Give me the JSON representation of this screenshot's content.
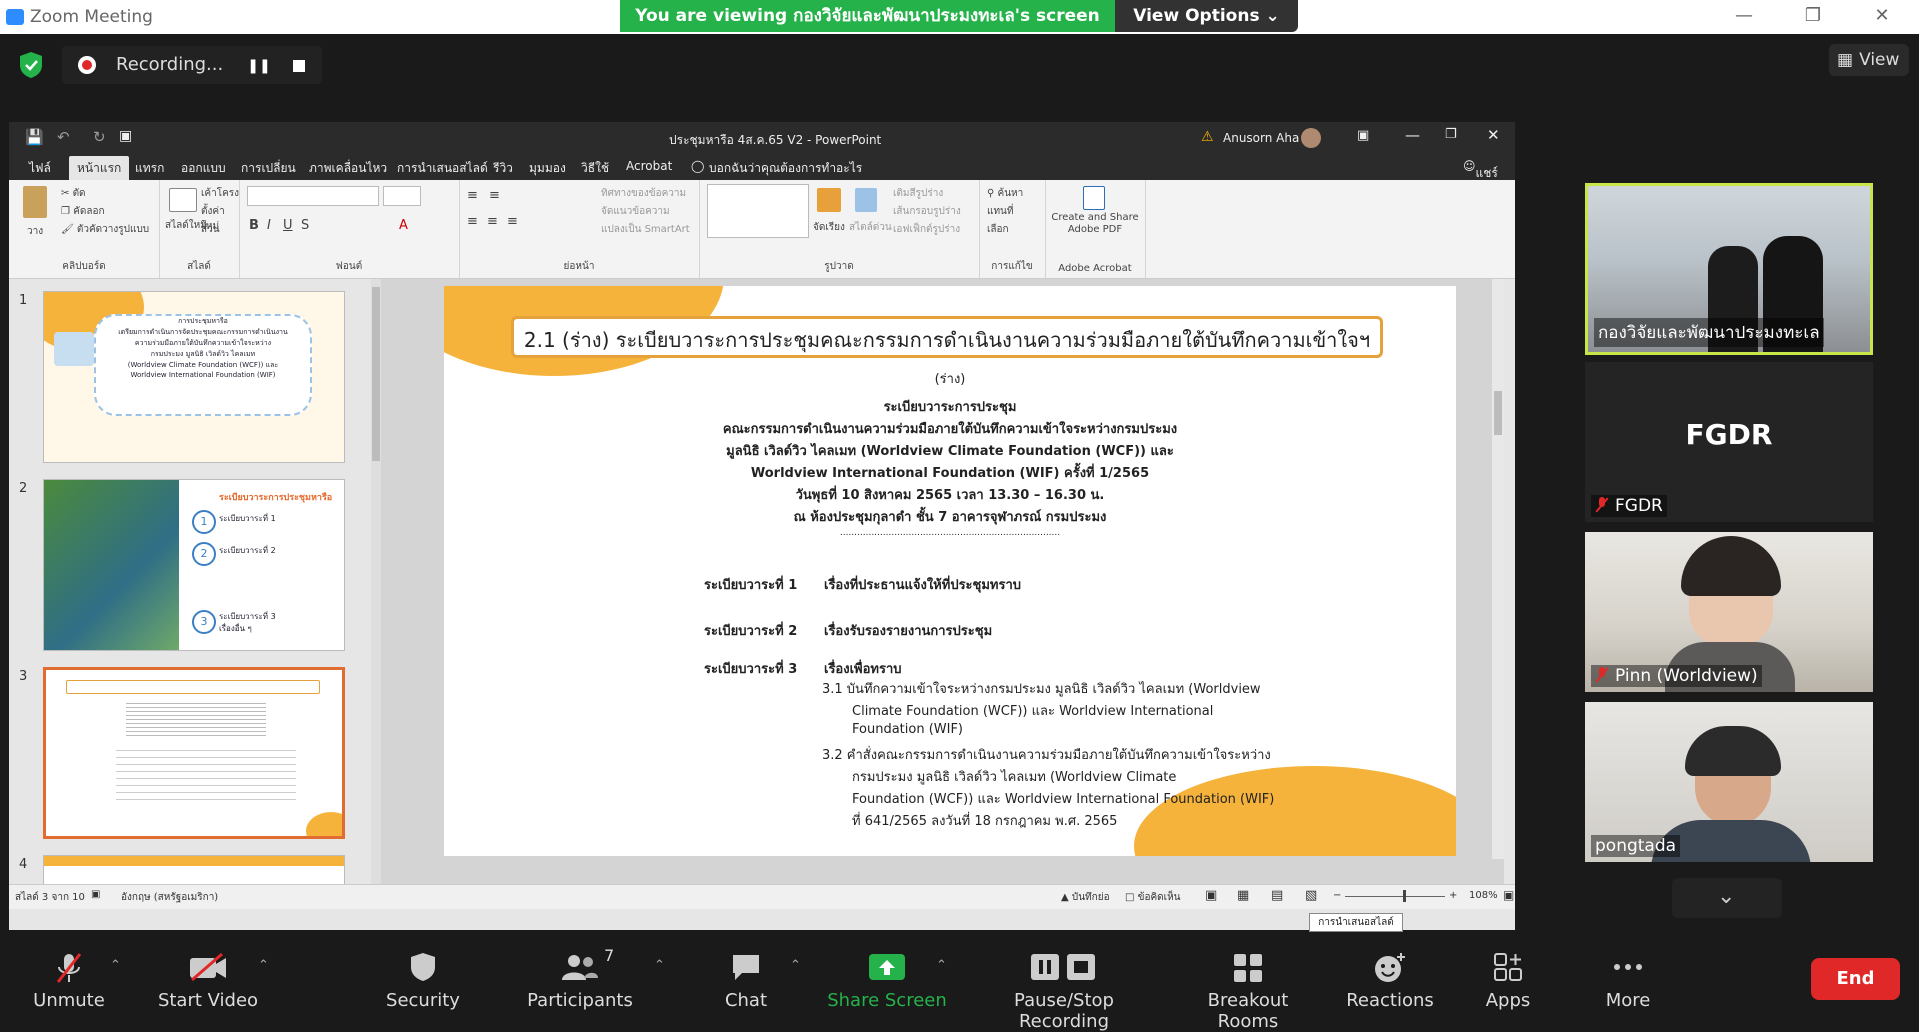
{
  "window": {
    "title": "Zoom Meeting"
  },
  "banner": {
    "viewing_text": "You are viewing กองวิจัยและพัฒนาประมงทะเล's screen",
    "view_options": "View Options"
  },
  "recording": {
    "label": "Recording..."
  },
  "view_button": {
    "label": "View"
  },
  "ppt": {
    "window_title": "ประชุมหารือ 4ส.ค.65 V2  -  PowerPoint",
    "user": "Anusorn Aha",
    "tabs": [
      "ไฟล์",
      "หน้าแรก",
      "แทรก",
      "ออกแบบ",
      "การเปลี่ยน",
      "ภาพเคลื่อนไหว",
      "การนำเสนอสไลด์",
      "รีวิว",
      "มุมมอง",
      "วิธีใช้",
      "Acrobat"
    ],
    "tell_me": "บอกฉันว่าคุณต้องการทำอะไร",
    "share": "แชร์",
    "ribbon_groups": [
      "คลิปบอร์ด",
      "สไลด์",
      "ฟอนต์",
      "ย่อหน้า",
      "รูปวาด",
      "การแก้ไข",
      "Adobe Acrobat"
    ],
    "ribbon_items": {
      "cut": "ตัด",
      "copy": "คัดลอก",
      "format_painter": "ตัวคัดวางรูปแบบ",
      "paste": "วาง",
      "new_slide": "สไลด์ใหม่",
      "layout": "เค้าโครง",
      "reset": "ตั้งค่าใหม่",
      "section": "ส่วน",
      "find": "ค้นหา",
      "replace": "แทนที่",
      "select": "เลือก",
      "create_pdf": "Create and Share Adobe PDF",
      "arrange": "จัดเรียง",
      "quick_styles": "สไตล์ด่วน",
      "text_direction": "ทิศทางของข้อความ",
      "align_text": "จัดแนวข้อความ",
      "smartart": "แปลงเป็น SmartArt",
      "shape_fill": "เติมสีรูปร่าง",
      "shape_outline": "เส้นกรอบรูปร่าง",
      "shape_effects": "เอฟเฟ็กต์รูปร่าง"
    },
    "slide_numbers": [
      "1",
      "2",
      "3",
      "4"
    ],
    "thumb1_lines": [
      "การประชุมหารือ",
      "เตรียมการดำเนินการจัดประชุมคณะกรรมการดำเนินงาน",
      "ความร่วมมือภายใต้บันทึกความเข้าใจระหว่าง",
      "กรมประมง มูลนิธิ เวิลด์วิว ไคลเมท",
      "(Worldview Climate Foundation (WCF)) และ",
      "Worldview International Foundation (WIF)"
    ],
    "thumb2_lines": [
      "ระเบียบวาระการประชุมหารือ",
      "ระเบียบวาระที่ 1",
      "ระเบียบวาระที่ 2",
      "ระเบียบวาระที่ 3",
      "เรื่องอื่น ๆ"
    ],
    "slide": {
      "title": "2.1 (ร่าง) ระเบียบวาระการประชุมคณะกรรมการดำเนินงานความร่วมมือภายใต้บันทึกความเข้าใจฯ",
      "draft": "(ร่าง)",
      "header_lines": [
        "ระเบียบวาระการประชุม",
        "คณะกรรมการดำเนินงานความร่วมมือภายใต้บันทึกความเข้าใจระหว่างกรมประมง",
        "มูลนิธิ เวิลด์วิว ไคลเมท (Worldview Climate Foundation (WCF)) และ",
        "Worldview International Foundation (WIF) ครั้งที่ 1/2565",
        "วันพุธที่ 10 สิงหาคม 2565 เวลา 13.30 – 16.30 น.",
        "ณ ห้องประชุมกุลาดำ ชั้น 7 อาคารจุฬาภรณ์ กรมประมง"
      ],
      "dots": ".............................................................................",
      "agenda": [
        {
          "no": "ระเบียบวาระที่ 1",
          "text": "เรื่องที่ประธานแจ้งให้ที่ประชุมทราบ"
        },
        {
          "no": "ระเบียบวาระที่ 2",
          "text": "เรื่องรับรองรายงานการประชุม"
        },
        {
          "no": "ระเบียบวาระที่ 3",
          "text": "เรื่องเพื่อทราบ"
        }
      ],
      "sub_items": [
        "3.1 บันทึกความเข้าใจระหว่างกรมประมง มูลนิธิ เวิลด์วิว ไคลเมท (Worldview",
        "Climate Foundation (WCF)) และ Worldview International",
        "Foundation (WIF)",
        "3.2 คำสั่งคณะกรรมการดำเนินงานความร่วมมือภายใต้บันทึกความเข้าใจระหว่าง",
        "กรมประมง มูลนิธิ เวิลด์วิว ไคลเมท (Worldview Climate",
        "Foundation (WCF)) และ Worldview International Foundation (WIF)",
        "ที่ 641/2565 ลงวันที่ 18 กรกฎาคม พ.ศ. 2565"
      ]
    },
    "status": {
      "slide_count": "สไลด์ 3 จาก 10",
      "language": "อังกฤษ (สหรัฐอเมริกา)",
      "notes": "บันทึกย่อ",
      "comments": "ข้อคิดเห็น",
      "zoom": "108%"
    },
    "tooltip": "การนำเสนอสไลด์"
  },
  "participants": [
    {
      "name": "กองวิจัยและพัฒนาประมงทะเล",
      "type": "video-active"
    },
    {
      "name": "FGDR",
      "display": "FGDR",
      "muted": true
    },
    {
      "name": "Pinn (Worldview)",
      "muted": true
    },
    {
      "name": "pongtada",
      "muted": false
    }
  ],
  "toolbar": {
    "unmute": "Unmute",
    "start_video": "Start Video",
    "security": "Security",
    "participants": "Participants",
    "participants_count": "7",
    "chat": "Chat",
    "share_screen": "Share Screen",
    "pause_stop": "Pause/Stop Recording",
    "breakout": "Breakout Rooms",
    "reactions": "Reactions",
    "apps": "Apps",
    "more": "More",
    "end": "End"
  },
  "colors": {
    "share_green": "#25b24a",
    "end_red": "#e02828",
    "active_speaker": "#c8e64a",
    "slide_accent": "#f5b33c"
  }
}
